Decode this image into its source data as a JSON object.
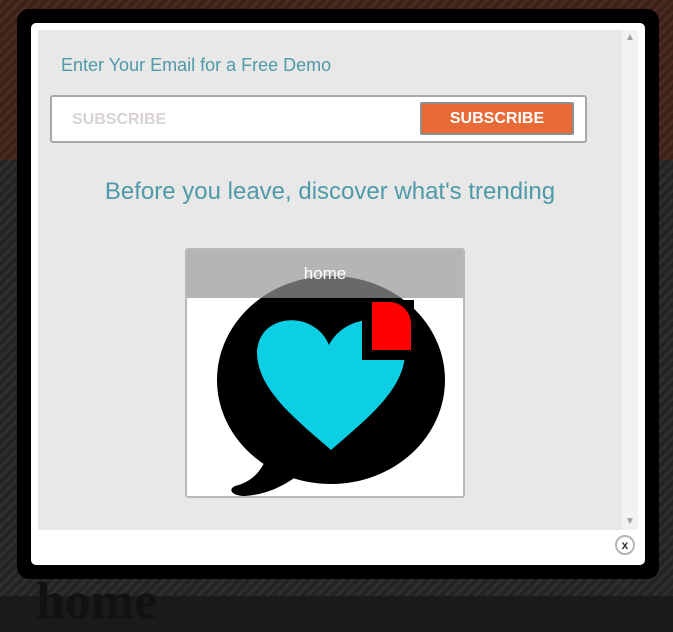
{
  "popup": {
    "email_heading": "Enter Your Email for a Free Demo",
    "email_placeholder": "SUBSCRIBE",
    "subscribe_label": "SUBSCRIBE",
    "trending_heading": "Before you leave, discover what's trending",
    "cards": [
      {
        "label": "home",
        "icon": "heart-speech-bubble-logo"
      }
    ],
    "close_label": "x",
    "scroll_up_icon": "▲",
    "scroll_down_icon": "▼"
  },
  "background": {
    "bottom_word": "home"
  },
  "colors": {
    "accent_text": "#4f9aa8",
    "subscribe_button": "#e86a37",
    "heart": "#0ccfe4",
    "corner_mark": "#ff0000"
  }
}
